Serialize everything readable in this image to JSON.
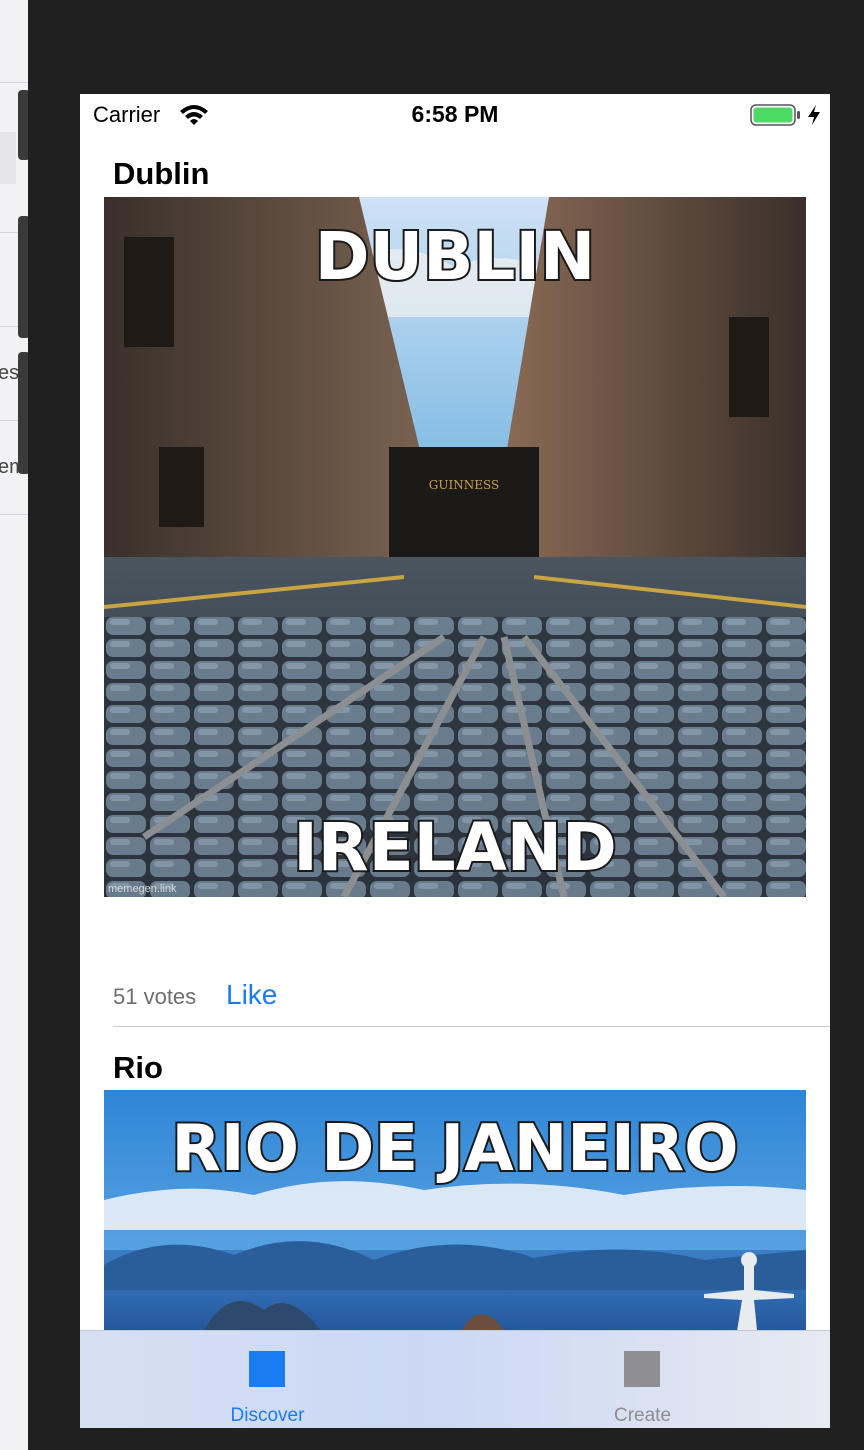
{
  "status_bar": {
    "carrier": "Carrier",
    "time": "6:58 PM"
  },
  "background_editor": {
    "frag1": "es",
    "frag2": "em"
  },
  "posts": [
    {
      "title": "Dublin",
      "image": {
        "top_caption": "DUBLIN",
        "bottom_caption": "IRELAND",
        "sign_text": "GUINNESS",
        "watermark": "memegen.link"
      },
      "votes": "51 votes",
      "like_label": "Like"
    },
    {
      "title": "Rio",
      "image": {
        "top_caption": "RIO DE JANEIRO"
      }
    }
  ],
  "tab_bar": {
    "tabs": [
      {
        "label": "Discover",
        "selected": true,
        "color": "#1b7cf2"
      },
      {
        "label": "Create",
        "selected": false,
        "color": "#8e8e93"
      }
    ]
  }
}
